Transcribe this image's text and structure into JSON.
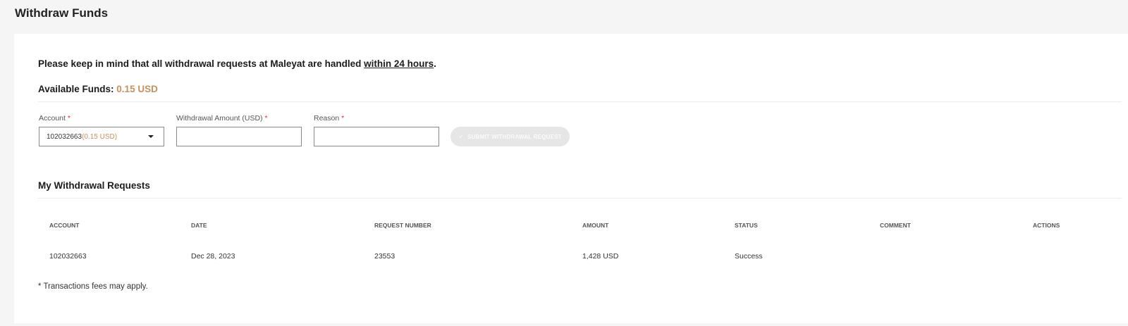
{
  "page": {
    "title": "Withdraw Funds"
  },
  "notice": {
    "prefix": "Please keep in mind that all withdrawal requests at Maleyat are handled ",
    "emphasis": "within 24 hours",
    "suffix": "."
  },
  "funds": {
    "label": "Available Funds:",
    "amount": "0.15 USD"
  },
  "form": {
    "account": {
      "label": "Account",
      "required_mark": "*",
      "selected_value": "102032663",
      "selected_balance": "(0.15 USD)"
    },
    "amount": {
      "label": "Withdrawal Amount (USD)",
      "required_mark": "*",
      "value": ""
    },
    "reason": {
      "label": "Reason",
      "required_mark": "*",
      "value": ""
    },
    "submit_label": "SUBMIT WITHDRAWAL REQUEST",
    "submit_icon": "check-icon",
    "submit_enabled": false
  },
  "requests": {
    "title": "My Withdrawal Requests",
    "columns": {
      "account": "ACCOUNT",
      "date": "DATE",
      "request_number": "REQUEST NUMBER",
      "amount": "AMOUNT",
      "status": "STATUS",
      "comment": "COMMENT",
      "actions": "ACTIONS"
    },
    "rows": [
      {
        "account": "102032663",
        "date": "Dec 28, 2023",
        "request_number": "23553",
        "amount": "1,428 USD",
        "status": "Success",
        "comment": "",
        "actions": ""
      }
    ]
  },
  "footnote": "* Transactions fees may apply.",
  "colors": {
    "accent": "#c4925a",
    "required": "#dd3333",
    "button_disabled": "#e6e6e6"
  }
}
